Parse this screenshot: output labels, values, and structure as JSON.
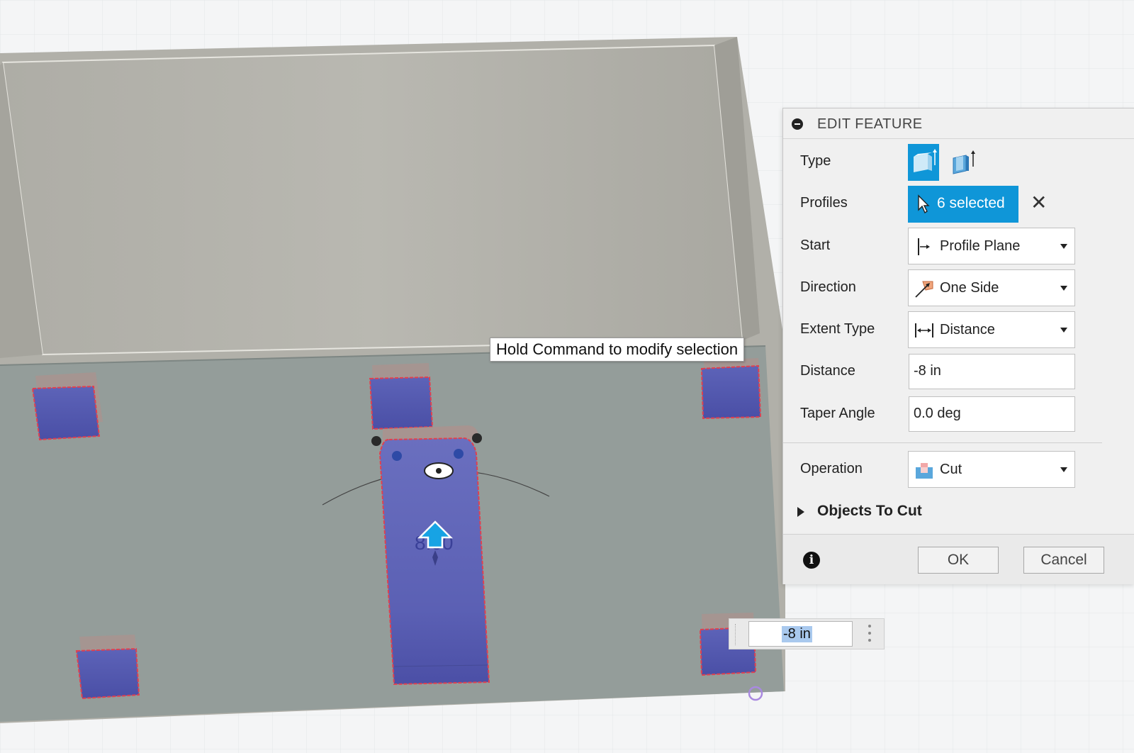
{
  "tooltip": {
    "text": "Hold Command to modify selection"
  },
  "viewport": {
    "dimension_label": "8.00",
    "distance_input_value": "-8 in"
  },
  "panel": {
    "title": "EDIT FEATURE",
    "type": {
      "label": "Type",
      "options": [
        "solid-extrude-icon",
        "thin-extrude-icon"
      ],
      "selected": "solid-extrude-icon"
    },
    "profiles": {
      "label": "Profiles",
      "value": "6 selected"
    },
    "start": {
      "label": "Start",
      "value": "Profile Plane"
    },
    "direction": {
      "label": "Direction",
      "value": "One Side"
    },
    "extent_type": {
      "label": "Extent Type",
      "value": "Distance"
    },
    "distance": {
      "label": "Distance",
      "value": "-8 in"
    },
    "taper_angle": {
      "label": "Taper Angle",
      "value": "0.0 deg"
    },
    "operation": {
      "label": "Operation",
      "value": "Cut"
    },
    "objects_to_cut": {
      "label": "Objects To Cut"
    },
    "ok_label": "OK",
    "cancel_label": "Cancel"
  },
  "colors": {
    "accent": "#0f96d8",
    "profile_fill": "#5b62b8",
    "profile_edge": "#e04050",
    "body": "#919b98",
    "wall": "#b6b5ae"
  }
}
